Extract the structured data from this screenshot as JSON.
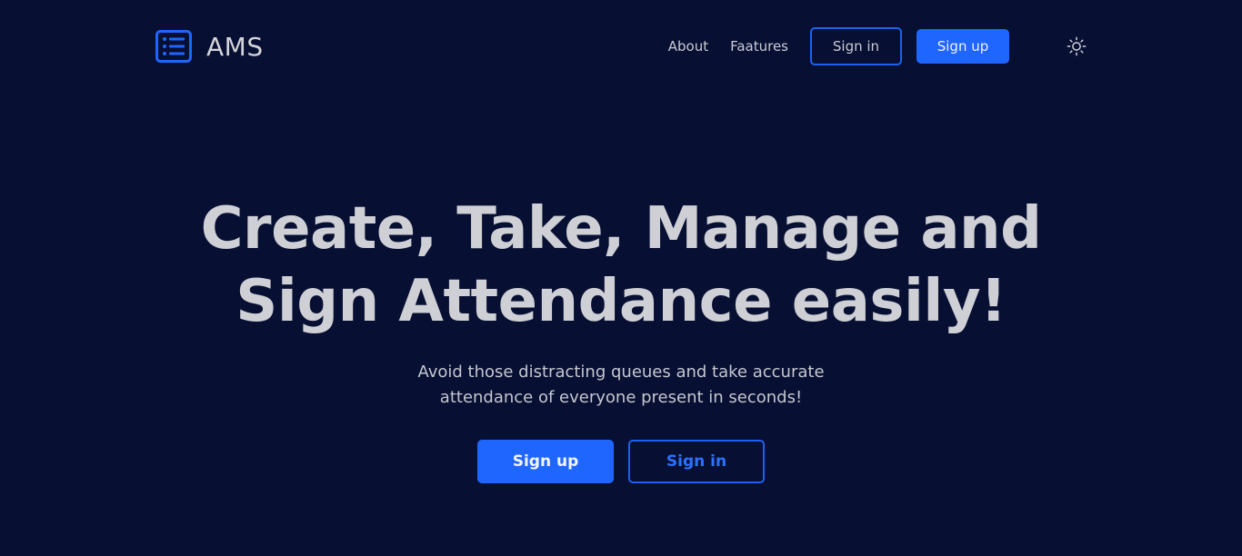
{
  "colors": {
    "background": "#070f33",
    "accent": "#1f66ff",
    "text": "#cfd0d5"
  },
  "navbar": {
    "brand_name": "AMS",
    "brand_icon": "list-icon",
    "links": [
      {
        "label": "About"
      },
      {
        "label": "Faatures"
      }
    ],
    "sign_in_label": "Sign in",
    "sign_up_label": "Sign up",
    "theme_toggle_icon": "sun-icon"
  },
  "hero": {
    "title_line1": "Create, Take, Manage and",
    "title_line2": "Sign Attendance easily!",
    "subtitle_line1": "Avoid those distracting queues and take accurate",
    "subtitle_line2": "attendance of everyone present in seconds!",
    "primary_button": "Sign up",
    "secondary_button": "Sign in"
  }
}
